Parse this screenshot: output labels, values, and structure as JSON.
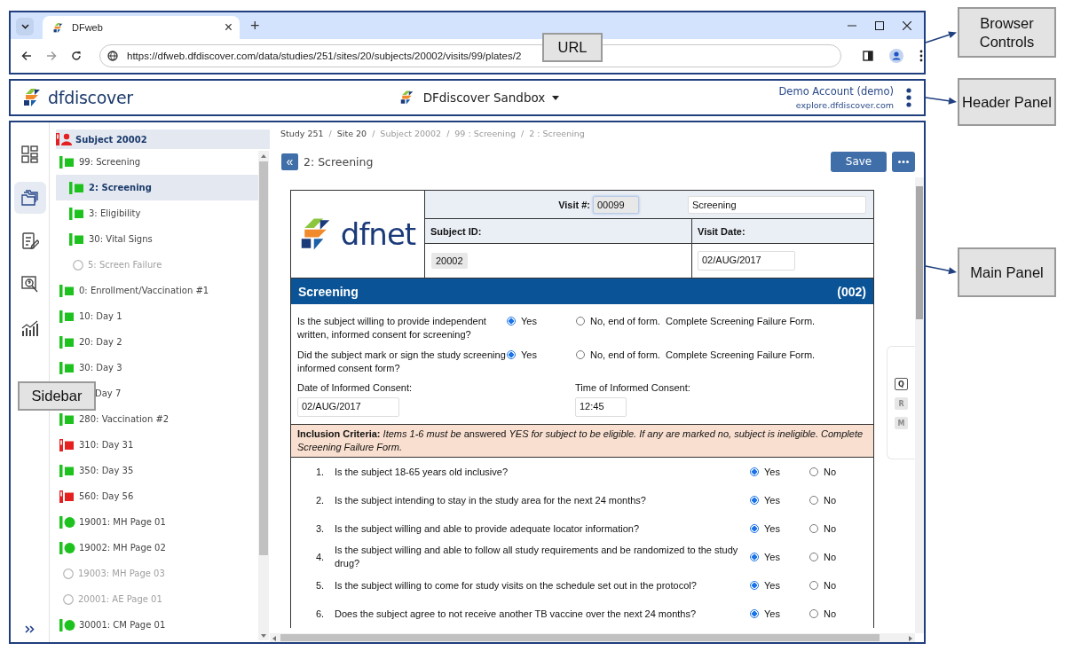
{
  "browser": {
    "tab_title": "DFweb",
    "close_tab": "×",
    "new_tab": "+",
    "url": "https://dfweb.dfdiscover.com/data/studies/251/sites/20/subjects/20002/visits/99/plates/2"
  },
  "header": {
    "app_name": "dfdiscover",
    "study": "DFdiscover Sandbox",
    "account": "Demo Account (demo)",
    "server": "explore.dfdiscover.com"
  },
  "sidebar": {
    "rail": [
      {
        "kind": "dashboard",
        "selected": false
      },
      {
        "kind": "folders",
        "selected": true
      },
      {
        "kind": "checklist",
        "selected": false
      },
      {
        "kind": "query",
        "selected": false
      },
      {
        "kind": "chart",
        "selected": false
      }
    ],
    "subject": {
      "label": "Subject 20002",
      "kind": "problem"
    },
    "visits": [
      {
        "label": "99: Screening",
        "kind": "done",
        "selected": false,
        "children": [
          {
            "label": "2: Screening",
            "kind": "done",
            "selected": true
          },
          {
            "label": "3: Eligibility",
            "kind": "done",
            "selected": false
          },
          {
            "label": "30: Vital Signs",
            "kind": "done",
            "selected": false
          },
          {
            "label": "5: Screen Failure",
            "kind": "empty",
            "selected": false
          }
        ]
      },
      {
        "label": "0: Enrollment/Vaccination #1",
        "kind": "done",
        "selected": false
      },
      {
        "label": "10: Day 1",
        "kind": "done",
        "selected": false
      },
      {
        "label": "20: Day 2",
        "kind": "done",
        "selected": false
      },
      {
        "label": "30: Day 3",
        "kind": "done",
        "selected": false
      },
      {
        "label": "Day 7",
        "selected": false
      },
      {
        "label": "280: Vaccination #2",
        "kind": "done",
        "selected": false
      },
      {
        "label": "310: Day 31",
        "kind": "problem",
        "selected": false
      },
      {
        "label": "350: Day 35",
        "kind": "done",
        "selected": false
      },
      {
        "label": "560: Day 56",
        "kind": "problem",
        "selected": false
      },
      {
        "label": "19001: MH Page 01",
        "kind": "done-round",
        "selected": false
      },
      {
        "label": "19002: MH Page 02",
        "kind": "done-round",
        "selected": false
      },
      {
        "label": "19003: MH Page 03",
        "kind": "empty",
        "selected": false
      },
      {
        "label": "20001: AE Page 01",
        "kind": "empty",
        "selected": false
      },
      {
        "label": "30001: CM Page 01",
        "kind": "done-round",
        "selected": false
      }
    ]
  },
  "main": {
    "breadcrumbs": [
      {
        "label": "Study 251",
        "linked": true,
        "separator": "/"
      },
      {
        "label": "Site 20",
        "linked": true,
        "separator": "/"
      },
      {
        "label": "Subject 20002",
        "linked": false,
        "separator": "/"
      },
      {
        "label": "99 : Screening",
        "linked": false,
        "separator": "/"
      },
      {
        "label": "2 : Screening",
        "linked": false
      }
    ],
    "collapse": "«",
    "title": "2: Screening",
    "save": "Save",
    "form": {
      "logo": "dfnet",
      "visit_label": "Visit #:",
      "visit_number": "00099",
      "visit_name": "Screening",
      "subject_label": "Subject ID:",
      "subject_id": "20002",
      "date_label": "Visit Date:",
      "visit_date": "02/AUG/2017",
      "section": "Screening",
      "section_code": "(002)",
      "consent_questions": [
        {
          "text": "Is the subject willing to provide independent written, informed consent for screening?",
          "options": [
            {
              "label": "Yes",
              "selected": true
            },
            {
              "label": "No, end of form.  Complete Screening Failure Form.",
              "selected": false
            }
          ]
        },
        {
          "text": "Did the subject mark or sign the study screening informed consent form?",
          "options": [
            {
              "label": "Yes",
              "selected": true
            },
            {
              "label": "No, end of form.  Complete Screening Failure Form.",
              "selected": false
            }
          ]
        }
      ],
      "consent_date_label": "Date of Informed Consent:",
      "consent_date": "02/AUG/2017",
      "consent_time_label": "Time of Informed Consent:",
      "consent_time": "12:45",
      "inclusion_note": "**Inclusion Criteria:** *Items 1-6 must be* answered *YES for subject to be eligible. If any are marked no, subject is ineligible. Complete Screening Failure Form.*",
      "criteria": [
        {
          "number": "1.",
          "text": "Is the subject 18-65 years old inclusive?",
          "options": [
            {
              "label": "Yes",
              "selected": true
            },
            {
              "label": "No",
              "selected": false
            }
          ]
        },
        {
          "number": "2.",
          "text": "Is the subject intending to stay in the study area for the next 24 months?",
          "options": [
            {
              "label": "Yes",
              "selected": true
            },
            {
              "label": "No",
              "selected": false
            }
          ]
        },
        {
          "number": "3.",
          "text": "Is the subject willing and able to provide adequate locator information?",
          "options": [
            {
              "label": "Yes",
              "selected": true
            },
            {
              "label": "No",
              "selected": false
            }
          ]
        },
        {
          "number": "4.",
          "text": "Is the subject willing and able to follow all study requirements and be randomized to the study drug?",
          "options": [
            {
              "label": "Yes",
              "selected": true
            },
            {
              "label": "No",
              "selected": false
            }
          ]
        },
        {
          "number": "5.",
          "text": "Is the subject willing to come for study visits on the schedule set out in the protocol?",
          "options": [
            {
              "label": "Yes",
              "selected": true
            },
            {
              "label": "No",
              "selected": false
            }
          ]
        },
        {
          "number": "6.",
          "text": "Does the subject agree to not receive another TB vaccine over the next 24 months?",
          "options": [
            {
              "label": "Yes",
              "selected": true
            },
            {
              "label": "No",
              "selected": false
            }
          ]
        }
      ]
    },
    "tools": [
      {
        "label": "Q",
        "enabled": true
      },
      {
        "label": "R",
        "enabled": false
      },
      {
        "label": "M",
        "enabled": false
      }
    ]
  },
  "annotations": [
    {
      "kind": "browser",
      "text": "Browser Controls"
    },
    {
      "kind": "url",
      "text": "URL"
    },
    {
      "kind": "header",
      "text": "Header Panel"
    },
    {
      "kind": "main",
      "text": "Main Panel"
    },
    {
      "kind": "sidebar",
      "text": "Sidebar"
    }
  ]
}
